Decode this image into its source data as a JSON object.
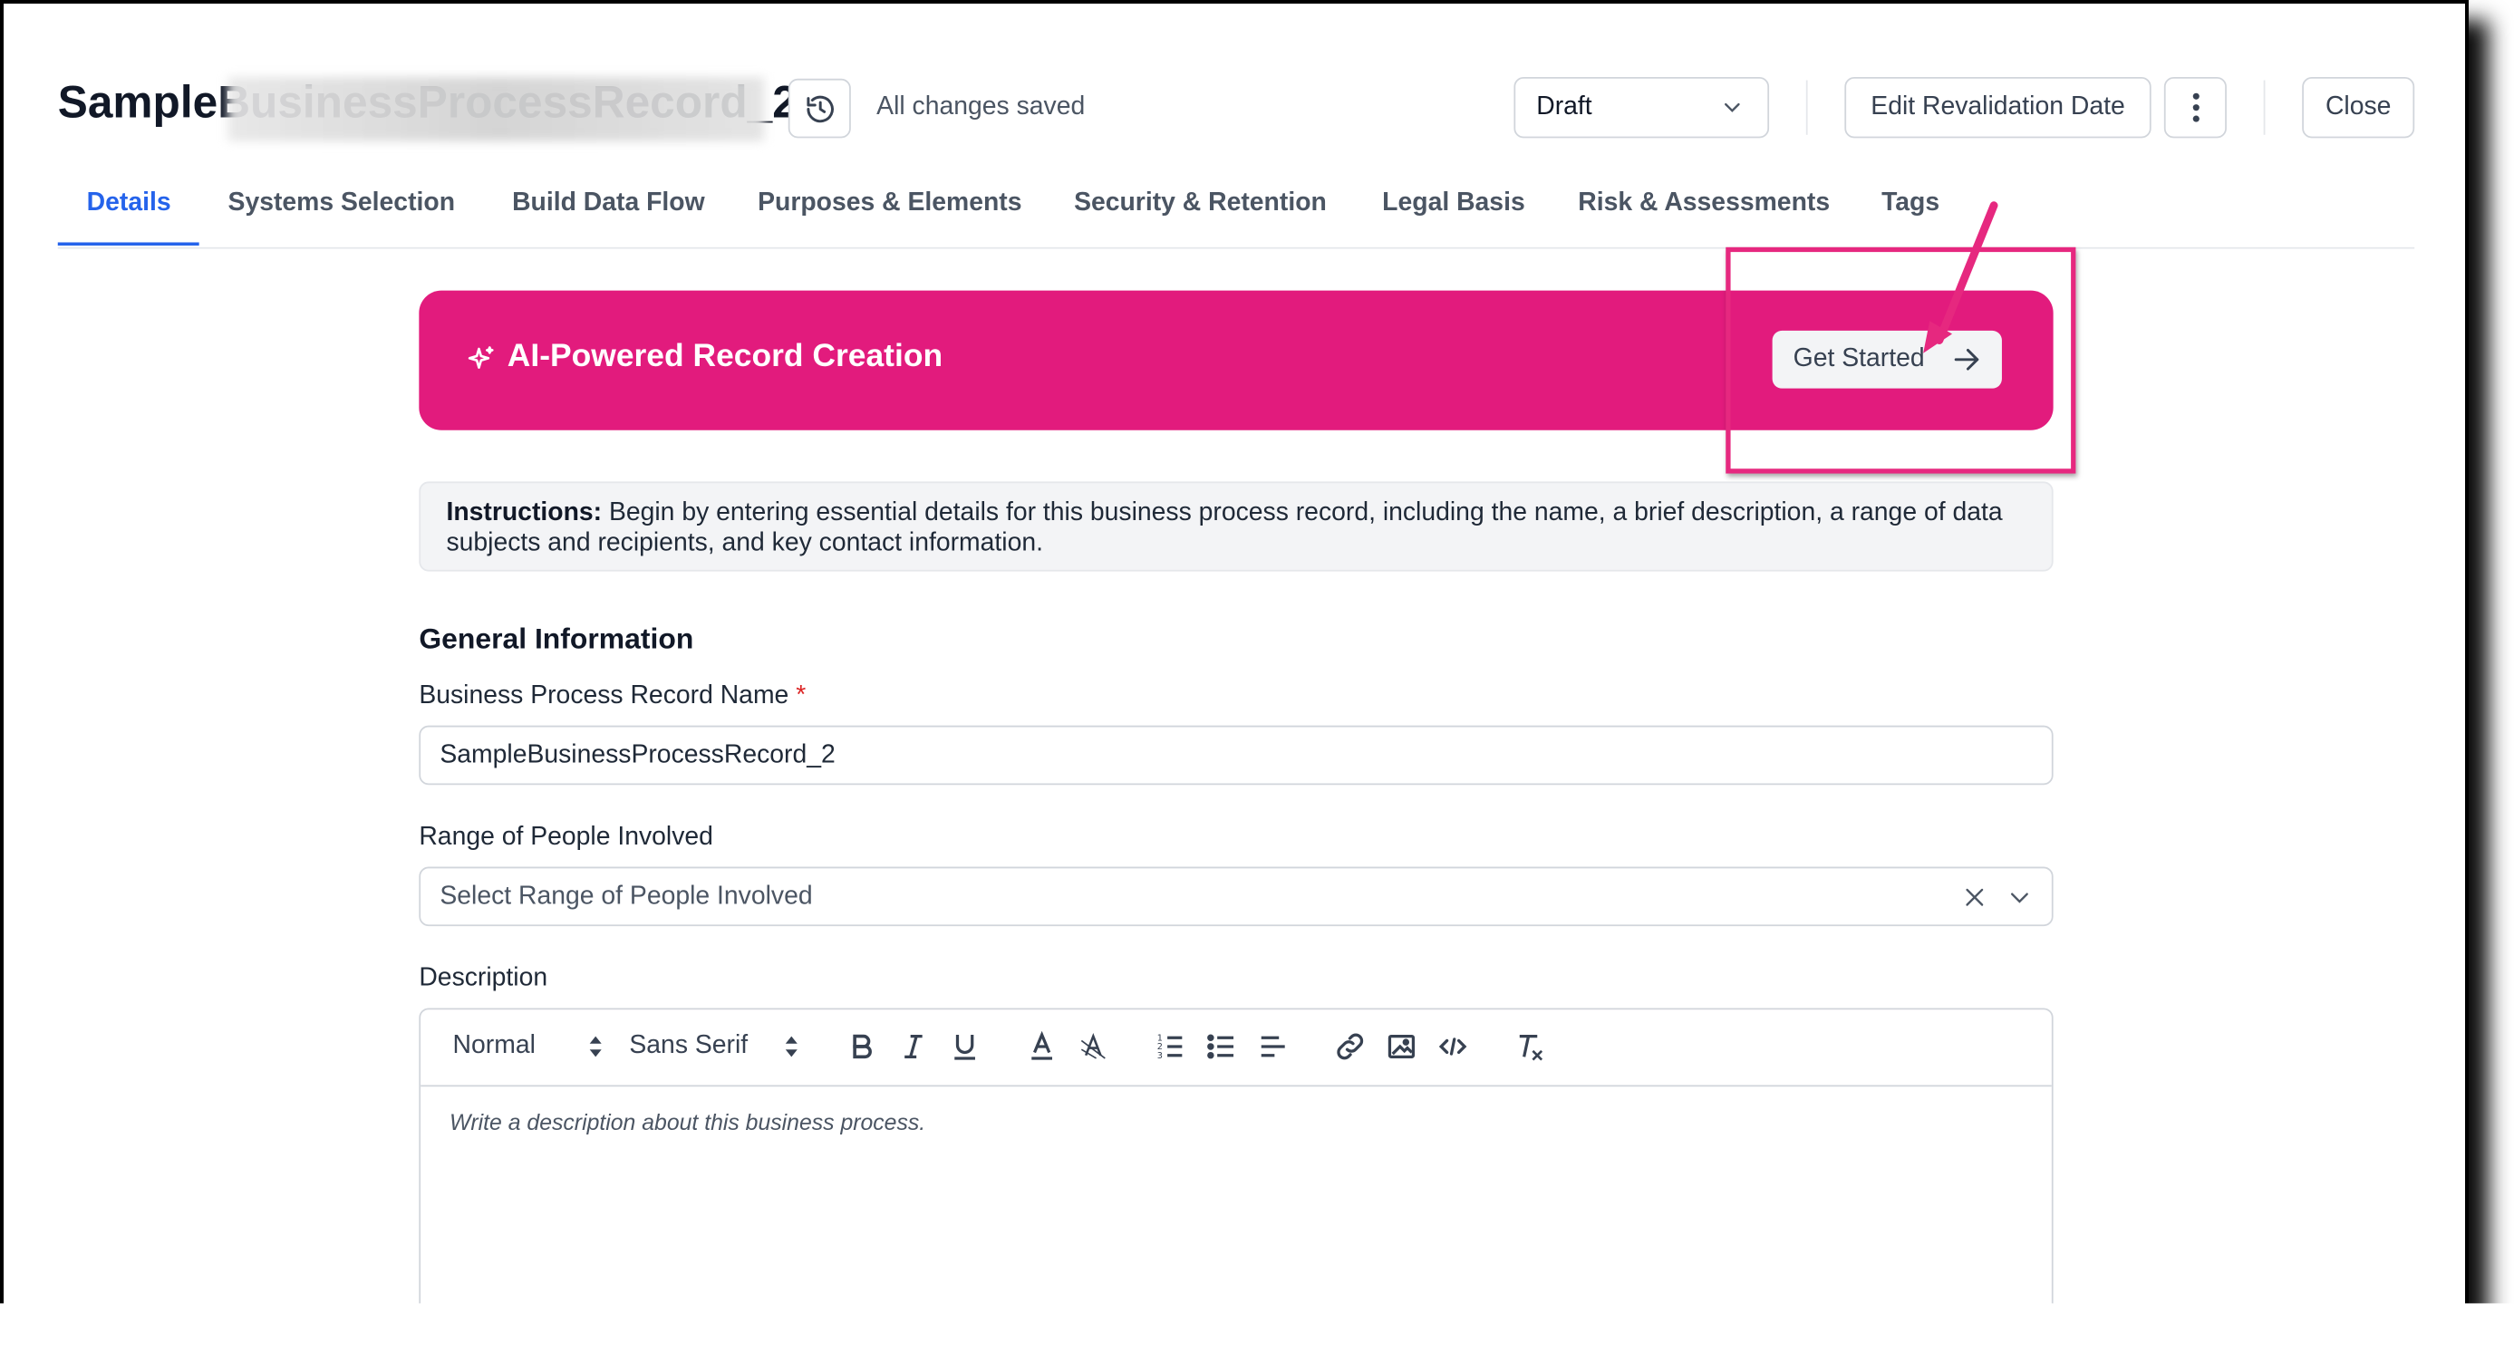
{
  "header": {
    "record_title": "SampleBusinessProcessRecord_2",
    "save_status": "All changes saved",
    "status_value": "Draft",
    "edit_revalidation_label": "Edit Revalidation Date",
    "close_label": "Close"
  },
  "tabs": [
    {
      "label": "Details",
      "active": true
    },
    {
      "label": "Systems Selection"
    },
    {
      "label": "Build Data Flow"
    },
    {
      "label": "Purposes & Elements"
    },
    {
      "label": "Security & Retention"
    },
    {
      "label": "Legal Basis"
    },
    {
      "label": "Risk & Assessments"
    },
    {
      "label": "Tags"
    }
  ],
  "banner": {
    "title": "AI-Powered Record Creation",
    "button_label": "Get Started",
    "color": "#e21b7d"
  },
  "instructions": {
    "label": "Instructions:",
    "text": " Begin by entering essential details for this business process record, including the name, a brief description, a range of data subjects and recipients, and key contact information."
  },
  "form": {
    "section_title": "General Information",
    "name_label": "Business Process Record Name",
    "required_mark": "*",
    "name_value": "SampleBusinessProcessRecord_2",
    "range_label": "Range of People Involved",
    "range_placeholder": "Select Range of People Involved",
    "description_label": "Description",
    "description_placeholder": "Write a description about this business process.",
    "toolbar": {
      "heading_select": "Normal",
      "font_select": "Sans Serif"
    }
  },
  "annotation": {
    "highlight_color": "#e6287f"
  }
}
